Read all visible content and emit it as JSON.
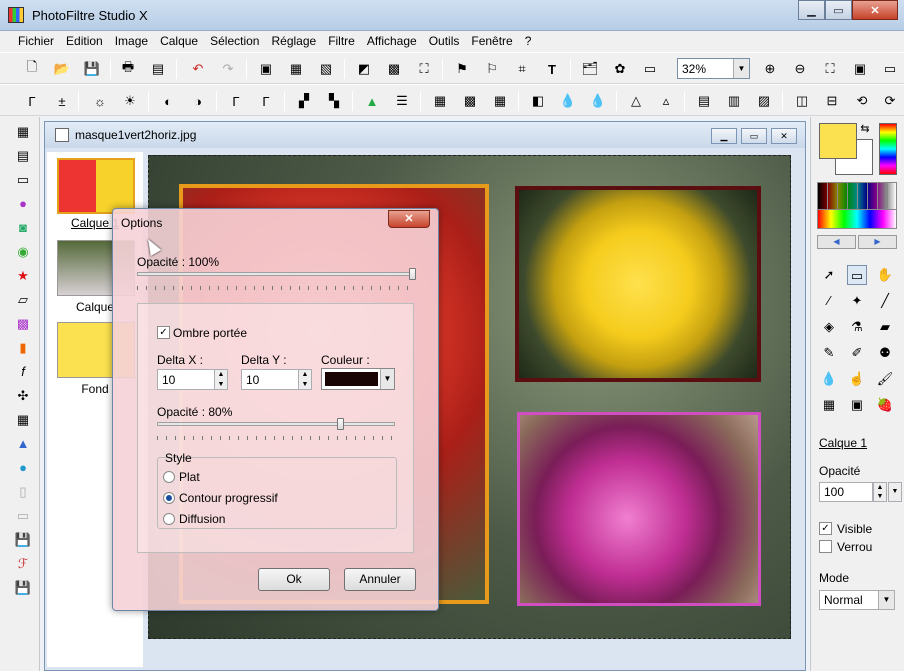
{
  "app": {
    "title": "PhotoFiltre Studio X"
  },
  "menu": [
    "Fichier",
    "Edition",
    "Image",
    "Calque",
    "Sélection",
    "Réglage",
    "Filtre",
    "Affichage",
    "Outils",
    "Fenêtre",
    "?"
  ],
  "toolbar": {
    "zoom_value": "32%"
  },
  "document": {
    "title": "masque1vert2horiz.jpg"
  },
  "layers_panel": {
    "items": [
      {
        "label": "Calque 1",
        "selected": true
      },
      {
        "label": "Calque"
      },
      {
        "label": "Fond"
      }
    ]
  },
  "dialog": {
    "title": "Options",
    "close_label": "✕",
    "opacity_label": "Opacité : 100%",
    "opacity_value": 100,
    "drop_shadow_label": "Ombre portée",
    "drop_shadow_checked": true,
    "delta_x_label": "Delta X :",
    "delta_x_value": "10",
    "delta_y_label": "Delta Y :",
    "delta_y_value": "10",
    "color_label": "Couleur :",
    "shadow_color": "#1a0505",
    "shadow_opacity_label": "Opacité : 80%",
    "shadow_opacity_value": 80,
    "style_label": "Style",
    "style_options": [
      "Plat",
      "Contour progressif",
      "Diffusion"
    ],
    "style_selected": "Contour progressif",
    "ok_label": "Ok",
    "cancel_label": "Annuler"
  },
  "right_panel": {
    "layer_link": "Calque 1",
    "opacity_label": "Opacité",
    "opacity_value": "100",
    "visible_label": "Visible",
    "visible_checked": true,
    "lock_label": "Verrou",
    "lock_checked": false,
    "mode_label": "Mode",
    "mode_value": "Normal",
    "foreground_color": "#fbe14f",
    "background_color": "#ffffff"
  },
  "colors": {
    "accent_orange": "#e89b1a",
    "frame_dark_red": "#5a0e10",
    "frame_pink": "#d04ec0"
  }
}
